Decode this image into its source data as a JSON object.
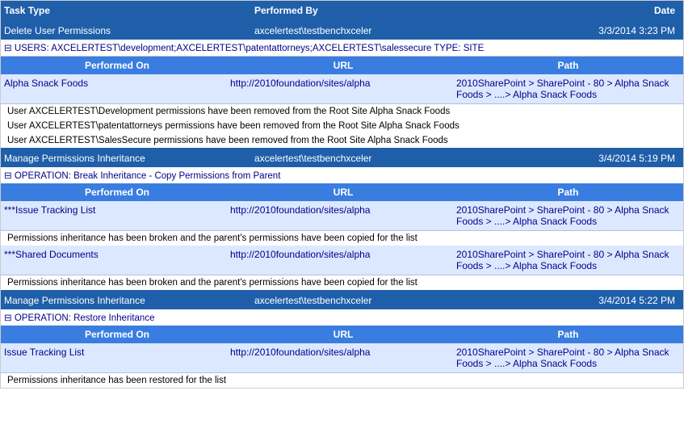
{
  "header": {
    "col_task": "Task Type",
    "col_by": "Performed By",
    "col_date": "Date"
  },
  "sections": [
    {
      "id": "section1",
      "task_type": "Delete User Permissions",
      "performed_by": "axcelertest\\testbenchxceler",
      "date": "3/3/2014 3:23 PM",
      "users_line": "⊟ USERS: AXCELERTEST\\development;AXCELERTEST\\patentattorneys;AXCELERTEST\\salessecure  TYPE: SITE",
      "sub_headers": {
        "on": "Performed On",
        "url": "URL",
        "path": "Path"
      },
      "data_rows": [
        {
          "performed_on": "Alpha Snack Foods",
          "url": "http://2010foundation/sites/alpha",
          "path": "2010SharePoint > SharePoint - 80 > Alpha Snack Foods > ....> Alpha Snack Foods"
        }
      ],
      "notes": [
        "User AXCELERTEST\\Development permissions have been removed from the  Root Site Alpha Snack Foods",
        "User AXCELERTEST\\patentattorneys permissions have been removed from the  Root Site Alpha Snack Foods",
        "User AXCELERTEST\\SalesSecure permissions have been removed from the  Root Site Alpha Snack Foods"
      ]
    },
    {
      "id": "section2",
      "task_type": "Manage Permissions Inheritance",
      "performed_by": "axcelertest\\testbenchxceler",
      "date": "3/4/2014 5:19 PM",
      "operation_line": "⊟ OPERATION: Break Inheritance - Copy Permissions from Parent",
      "sub_headers": {
        "on": "Performed On",
        "url": "URL",
        "path": "Path"
      },
      "data_rows": [
        {
          "performed_on": "***Issue Tracking List",
          "url": "http://2010foundation/sites/alpha",
          "path": "2010SharePoint > SharePoint - 80 > Alpha Snack Foods > ....> Alpha Snack Foods",
          "note": "Permissions inheritance has been broken and the parent's permissions have been copied for the list"
        },
        {
          "performed_on": "***Shared Documents",
          "url": "http://2010foundation/sites/alpha",
          "path": "2010SharePoint > SharePoint - 80 > Alpha Snack Foods > ....> Alpha Snack Foods",
          "note": "Permissions inheritance has been broken and the parent's permissions have been copied for the list"
        }
      ],
      "notes": []
    },
    {
      "id": "section3",
      "task_type": "Manage Permissions Inheritance",
      "performed_by": "axcelertest\\testbenchxceler",
      "date": "3/4/2014 5:22 PM",
      "operation_line": "⊟ OPERATION: Restore Inheritance",
      "sub_headers": {
        "on": "Performed On",
        "url": "URL",
        "path": "Path"
      },
      "data_rows": [
        {
          "performed_on": "Issue Tracking List",
          "url": "http://2010foundation/sites/alpha",
          "path": "2010SharePoint > SharePoint - 80 > Alpha Snack Foods > ....> Alpha Snack Foods"
        }
      ],
      "notes": [
        "Permissions inheritance has been restored for the list"
      ]
    }
  ]
}
